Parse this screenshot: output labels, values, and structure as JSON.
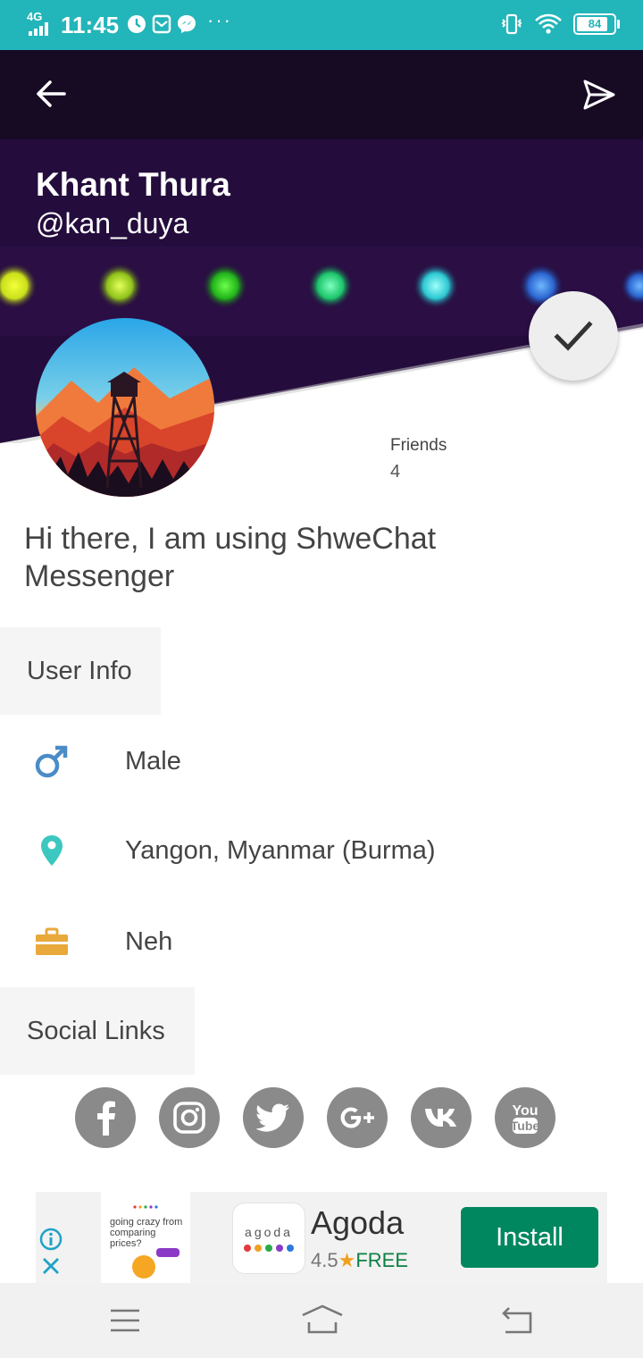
{
  "status_bar": {
    "network": "4G",
    "time": "11:45",
    "more": "···",
    "battery": "84",
    "icons": [
      "clock-icon",
      "mail-icon",
      "messenger-icon",
      "vibrate-icon",
      "wifi-icon",
      "battery-icon"
    ]
  },
  "toolbar": {
    "back_icon": "arrow-left-icon",
    "send_icon": "send-icon"
  },
  "profile": {
    "name": "Khant Thura",
    "handle": "@kan_duya",
    "friends_label": "Friends",
    "friends_count": "4",
    "status": "Hi there, I am using ShweChat Messenger"
  },
  "user_info": {
    "title": "User Info",
    "gender": "Male",
    "location": "Yangon, Myanmar (Burma)",
    "work": "Neh"
  },
  "social_links": {
    "title": "Social Links",
    "items": [
      "facebook",
      "instagram",
      "twitter",
      "google-plus",
      "vk",
      "youtube"
    ]
  },
  "ad": {
    "thumb_text": "going crazy from comparing prices?",
    "logo_text": "agoda",
    "name": "Agoda",
    "rating": "4.5",
    "price": "FREE",
    "install_label": "Install"
  },
  "colors": {
    "status_bar": "#22b5b9",
    "cover": "#1e0a33",
    "gender_icon": "#4a8cc7",
    "location_icon": "#3cc7c0",
    "work_icon": "#e8a93a",
    "install": "#01875f"
  }
}
